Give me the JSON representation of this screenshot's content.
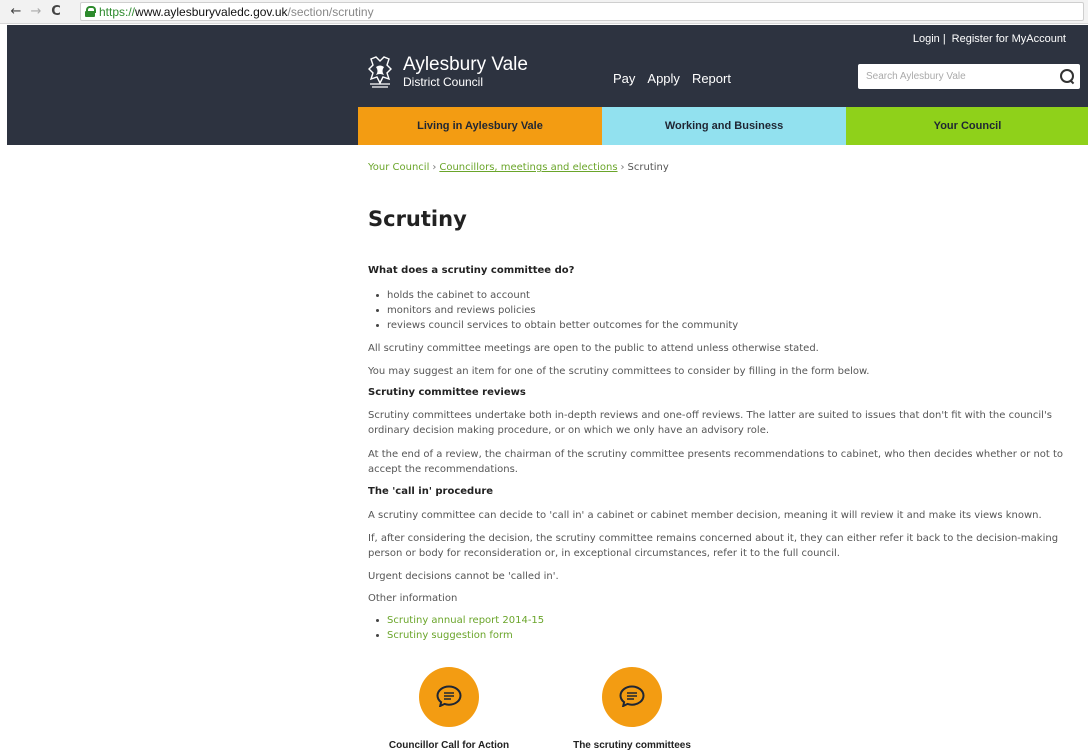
{
  "browser": {
    "url_scheme": "https://",
    "url_host": "www.aylesburyvaledc.gov.uk",
    "url_path": "/section/scrutiny",
    "back_glyph": "←",
    "forward_glyph": "→",
    "reload_glyph": "C"
  },
  "header": {
    "login": "Login |",
    "register": "Register for MyAccount",
    "logo_line1": "Aylesbury Vale",
    "logo_line2": "District Council",
    "nav": [
      "Pay",
      "Apply",
      "Report"
    ],
    "search_placeholder": "Search Aylesbury Vale",
    "tabs": [
      {
        "label": "Living in Aylesbury Vale",
        "color": "#f39c12"
      },
      {
        "label": "Working and Business",
        "color": "#92e1ef"
      },
      {
        "label": "Your Council",
        "color": "#8fd11a"
      }
    ],
    "bg_color": "#2d3340"
  },
  "breadcrumb": {
    "items": [
      "Your Council",
      "Councillors, meetings and elections",
      "Scrutiny"
    ],
    "separator": "›"
  },
  "page": {
    "title": "Scrutiny",
    "h1": "What does a scrutiny committee do?",
    "bullets1": [
      "holds the cabinet to account",
      "monitors and reviews policies",
      "reviews council services to obtain better outcomes for the community"
    ],
    "p1": "All scrutiny committee meetings are open to the public to attend unless otherwise stated.",
    "p2": "You may suggest an item for one of the scrutiny committees to consider by filling in the form below.",
    "h2": "Scrutiny committee reviews",
    "p3": "Scrutiny committees undertake both in-depth reviews and one-off reviews. The latter are suited to issues that don't fit with the council's ordinary decision making procedure, or on which we only have an advisory role.",
    "p4": "At the end of a review, the chairman of the scrutiny committee presents recommendations to cabinet, who then decides whether or not to accept the recommendations.",
    "h3": "The 'call in' procedure",
    "p5": "A scrutiny committee can decide to 'call in' a cabinet or cabinet member decision, meaning it will review it and make its views known.",
    "p6": "If, after considering the decision, the scrutiny committee remains concerned about it, they can either refer it back to the decision-making person or body for reconsideration or, in exceptional circumstances, refer it to the full council.",
    "p7": "Urgent decisions cannot be 'called in'.",
    "p8": "Other information",
    "links": [
      "Scrutiny annual report 2014-15",
      "Scrutiny suggestion form"
    ],
    "promos": [
      "Councillor Call for Action",
      "The scrutiny committees"
    ],
    "link_color": "#6aa52a"
  }
}
